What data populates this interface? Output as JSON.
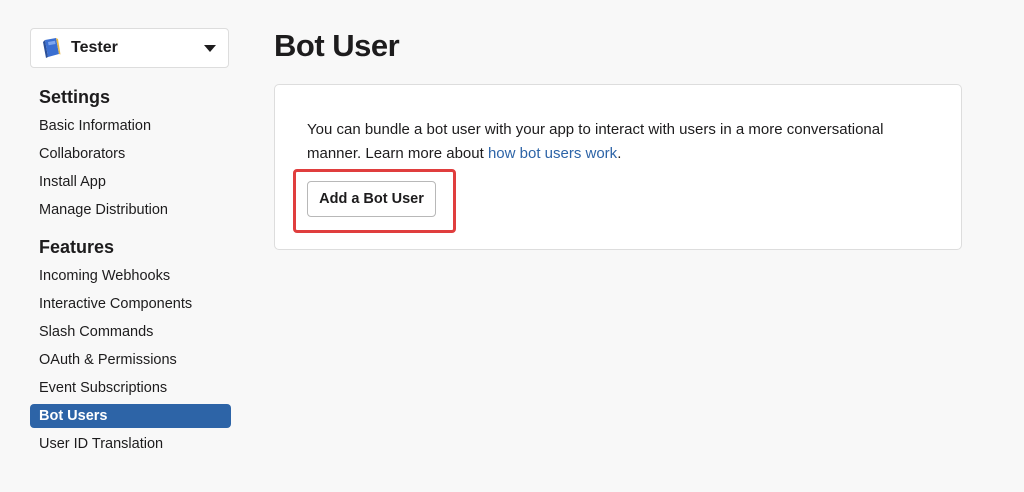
{
  "app_selector": {
    "name": "Tester",
    "icon": "blue-book-icon"
  },
  "sidebar": {
    "settings_heading": "Settings",
    "settings_items": [
      {
        "label": "Basic Information"
      },
      {
        "label": "Collaborators"
      },
      {
        "label": "Install App"
      },
      {
        "label": "Manage Distribution"
      }
    ],
    "features_heading": "Features",
    "features_items": [
      {
        "label": "Incoming Webhooks"
      },
      {
        "label": "Interactive Components"
      },
      {
        "label": "Slash Commands"
      },
      {
        "label": "OAuth & Permissions"
      },
      {
        "label": "Event Subscriptions"
      },
      {
        "label": "Bot Users",
        "active": true
      },
      {
        "label": "User ID Translation"
      }
    ]
  },
  "main": {
    "title": "Bot User",
    "description_text": "You can bundle a bot user with your app to interact with users in a more conversational manner. Learn more about ",
    "description_link": "how bot users work",
    "description_end": ".",
    "button_label": "Add a Bot User"
  },
  "colors": {
    "accent": "#2d64a7",
    "highlight": "#e03e3e",
    "background": "#f8f8f8"
  }
}
